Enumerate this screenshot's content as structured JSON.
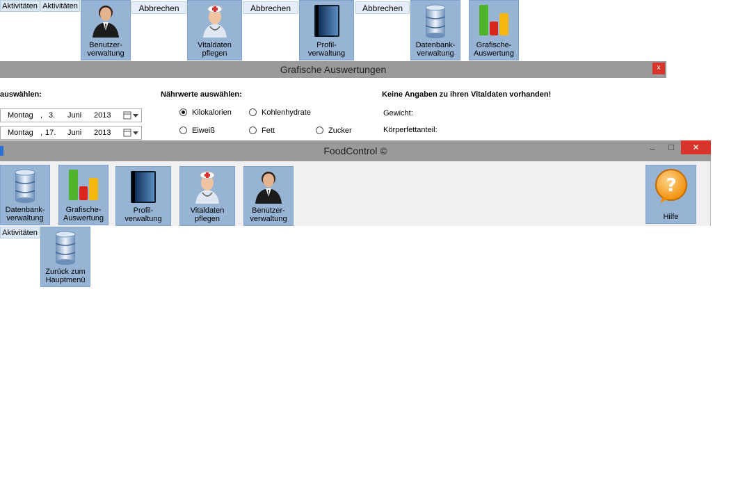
{
  "top_row": {
    "tab1": "Aktivitäten",
    "tab2": "Aktivitäten",
    "tiles": [
      {
        "label": "Benutzer-\nverwaltung",
        "icon": "user-icon"
      },
      {
        "label": "Vitaldaten\npflegen",
        "icon": "doctor-icon"
      },
      {
        "label": "Profil-\nverwaltung",
        "icon": "book-icon"
      },
      {
        "label": "Datenbank-\nverwaltung",
        "icon": "database-icon"
      },
      {
        "label": "Grafische-\nAuswertung",
        "icon": "bar-chart-icon"
      }
    ],
    "cancel_labels": [
      "Abbrechen",
      "Abbrechen",
      "Abbrechen"
    ]
  },
  "grafik_window": {
    "title": "Grafische Auswertungen",
    "close": "x",
    "date_section_title": "auswählen:",
    "dates": [
      {
        "weekday": "Montag",
        "sep": ",",
        "day": "3.",
        "month": "Juni",
        "year": "2013"
      },
      {
        "weekday": "Montag",
        "sep": ",",
        "day": "17.",
        "month": "Juni",
        "year": "2013"
      }
    ],
    "nutrients_title": "Nährwerte auswählen:",
    "nutrients": [
      "Kilokalorien",
      "Kohlenhydrate",
      "Eiweiß",
      "Fett",
      "Zucker"
    ],
    "selected_nutrient": "Kilokalorien",
    "vital_title": "Keine Angaben zu ihren Vitaldaten vorhanden!",
    "vital_fields": [
      "Gewicht:",
      "Körperfettanteil:"
    ]
  },
  "main_window": {
    "title": "FoodControl ©",
    "controls": {
      "minimize": "–",
      "maximize": "□",
      "close": "✕"
    },
    "tiles": [
      {
        "label": "Datenbank-\nverwaltung",
        "icon": "database-icon"
      },
      {
        "label": "Grafische-\nAuswertung",
        "icon": "bar-chart-icon"
      },
      {
        "label": "Profil-\nverwaltung",
        "icon": "book-icon"
      },
      {
        "label": "Vitaldaten\npflegen",
        "icon": "doctor-icon"
      },
      {
        "label": "Benutzer-\nverwaltung",
        "icon": "user-icon"
      }
    ],
    "help_label": "Hilfe"
  },
  "bottom": {
    "tab": "Aktivitäten",
    "back_tile": "Zurück zum\nHauptmenü"
  },
  "colors": {
    "tile_bg": "#97b4d4",
    "title_bar": "#9a9a9a",
    "close_red": "#d9342b"
  }
}
